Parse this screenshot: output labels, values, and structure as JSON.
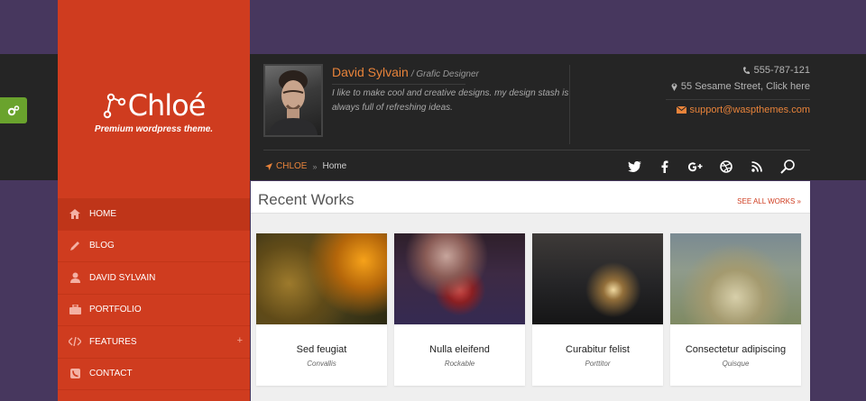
{
  "brand": {
    "logo_text": "Chloé",
    "tagline": "Premium wordpress theme.",
    "accent": "#cf3c1f"
  },
  "nav": [
    {
      "label": "HOME",
      "icon": "home-icon",
      "active": true
    },
    {
      "label": "BLOG",
      "icon": "pencil-icon"
    },
    {
      "label": "DAVID SYLVAIN",
      "icon": "user-icon"
    },
    {
      "label": "PORTFOLIO",
      "icon": "briefcase-icon"
    },
    {
      "label": "FEATURES",
      "icon": "code-icon",
      "plus": "+"
    },
    {
      "label": "CONTACT",
      "icon": "phone-icon"
    }
  ],
  "profile": {
    "name": "David Sylvain",
    "role": "/ Grafic Designer",
    "bio": "I like to make cool and creative designs. my design stash is always full of refreshing ideas."
  },
  "contact": {
    "phone": "555-787-121",
    "address": "55 Sesame Street, Click here",
    "email": "support@waspthemes.com"
  },
  "breadcrumb": {
    "home": "CHLOE",
    "current": "Home"
  },
  "social_icons": [
    "twitter-icon",
    "facebook-icon",
    "google-plus-icon",
    "dribbble-icon",
    "rss-icon",
    "search-icon"
  ],
  "section": {
    "title": "Recent Works",
    "see_all": "SEE ALL WORKS »"
  },
  "works": [
    {
      "title": "Sed feugiat",
      "category": "Convallis"
    },
    {
      "title": "Nulla eleifend",
      "category": "Rockable"
    },
    {
      "title": "Curabitur felist",
      "category": "Porttitor"
    },
    {
      "title": "Consectetur adipiscing",
      "category": "Quisque"
    }
  ]
}
